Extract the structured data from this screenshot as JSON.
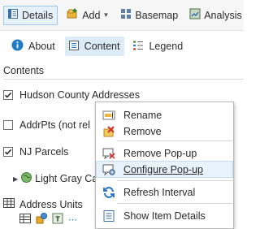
{
  "toolbar": {
    "details": "Details",
    "add": "Add",
    "basemap": "Basemap",
    "analysis": "Analysis"
  },
  "subtabs": {
    "about": "About",
    "content": "Content",
    "legend": "Legend"
  },
  "contents_title": "Contents",
  "layers": [
    {
      "label": "Hudson County Addresses",
      "checked": true
    },
    {
      "label": "AddrPts (not rel",
      "checked": false
    },
    {
      "label": "NJ Parcels",
      "checked": true
    },
    {
      "label": "Light Gray Ca"
    },
    {
      "label": "Address Units"
    }
  ],
  "context_menu": {
    "items": [
      {
        "label": "Rename",
        "icon": "rename-icon"
      },
      {
        "label": "Remove",
        "icon": "remove-icon"
      },
      {
        "label": "Remove Pop-up",
        "icon": "remove-popup-icon"
      },
      {
        "label": "Configure Pop-up",
        "icon": "configure-popup-icon",
        "hovered": true
      },
      {
        "label": "Refresh Interval",
        "icon": "refresh-icon"
      },
      {
        "label": "Show Item Details",
        "icon": "item-details-icon"
      }
    ]
  },
  "colors": {
    "accent": "#1f7bc4",
    "active_tab_bg": "#dcebf8",
    "hover_bg": "#e8f2fb"
  }
}
